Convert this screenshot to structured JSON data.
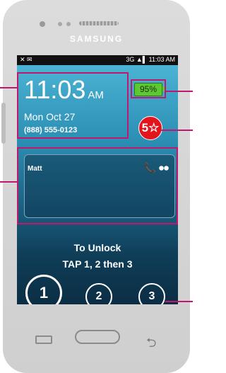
{
  "device": {
    "brand": "SAMSUNG"
  },
  "statusbar": {
    "left_icons": "✕ ✉",
    "right_text": "3G ▲▌ 11:03 AM"
  },
  "lockscreen": {
    "time": "11:03",
    "ampm": "AM",
    "date": "Mon Oct 27",
    "phone_number": "(888) 555-0123",
    "battery_percent": "95%",
    "badge": "5☆",
    "message_name": "Matt",
    "message_icons": "📞 ⏺⏺",
    "unlock_line1": "To Unlock",
    "unlock_line2": "TAP 1, 2 then 3",
    "buttons": [
      "1",
      "2",
      "3"
    ]
  },
  "nav": {
    "back_symbol": "⮌"
  },
  "colors": {
    "callout": "#c0186c",
    "battery": "#5cc832",
    "badge": "#e4141d"
  }
}
